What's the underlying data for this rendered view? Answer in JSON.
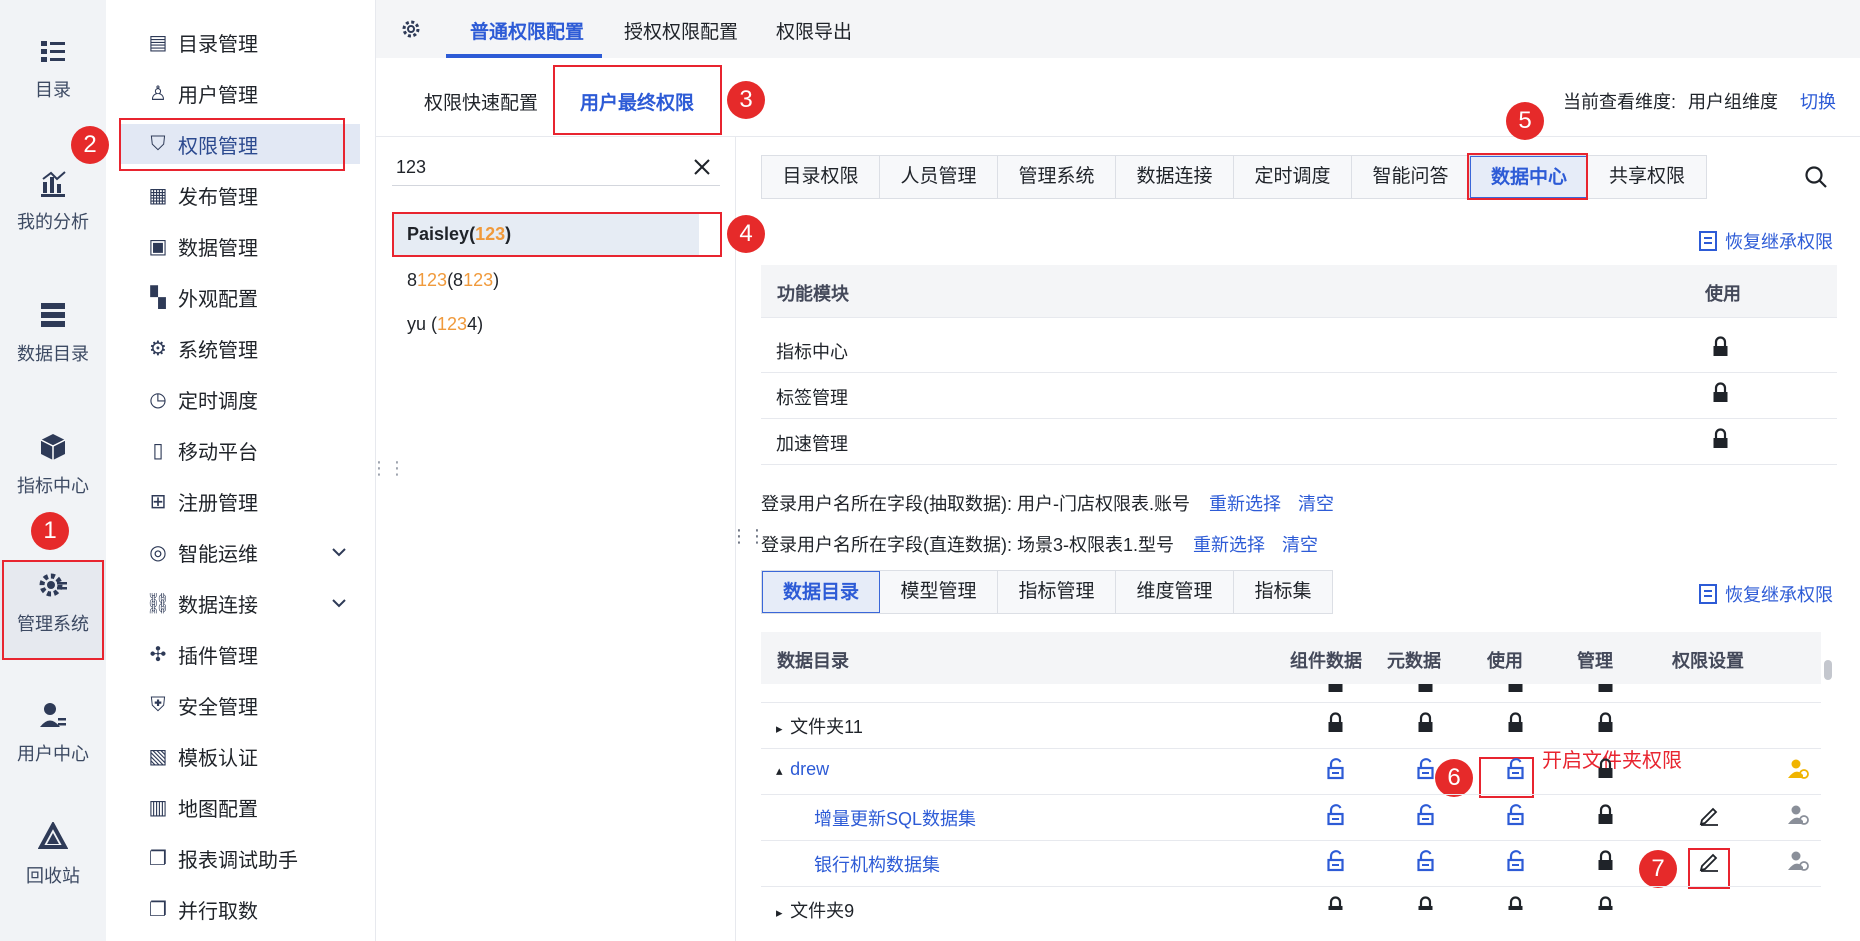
{
  "rail": {
    "items": [
      {
        "label": "目录",
        "icon": "catalog-icon"
      },
      {
        "label": "我的分析",
        "icon": "analysis-icon"
      },
      {
        "label": "数据目录",
        "icon": "data-catalog-icon"
      },
      {
        "label": "指标中心",
        "icon": "cube-icon"
      },
      {
        "label": "管理系统",
        "icon": "gear-icon"
      },
      {
        "label": "用户中心",
        "icon": "user-icon"
      },
      {
        "label": "回收站",
        "icon": "recycle-icon"
      }
    ]
  },
  "menu": {
    "items": [
      {
        "label": "目录管理"
      },
      {
        "label": "用户管理"
      },
      {
        "label": "权限管理"
      },
      {
        "label": "发布管理"
      },
      {
        "label": "数据管理"
      },
      {
        "label": "外观配置"
      },
      {
        "label": "系统管理"
      },
      {
        "label": "定时调度"
      },
      {
        "label": "移动平台"
      },
      {
        "label": "注册管理"
      },
      {
        "label": "智能运维"
      },
      {
        "label": "数据连接"
      },
      {
        "label": "插件管理"
      },
      {
        "label": "安全管理"
      },
      {
        "label": "模板认证"
      },
      {
        "label": "地图配置"
      },
      {
        "label": "报表调试助手"
      },
      {
        "label": "并行取数"
      }
    ]
  },
  "top_tabs": [
    "普通权限配置",
    "授权权限配置",
    "权限导出"
  ],
  "sub_tabs": [
    "权限快速配置",
    "用户最终权限"
  ],
  "dimension": {
    "label": "当前查看维度:",
    "value": "用户组维度",
    "switch": "切换"
  },
  "search": {
    "value": "123"
  },
  "users": [
    {
      "name": "Paisley",
      "open": " (",
      "match": "123",
      "close": ")"
    },
    {
      "pre": "8",
      "match": "123",
      "mid": " (8",
      "match2": "123",
      "close": ")"
    },
    {
      "pre": "yu (",
      "match": "123",
      "close": "4)"
    }
  ],
  "perm_tabs": [
    "目录权限",
    "人员管理",
    "管理系统",
    "数据连接",
    "定时调度",
    "智能问答",
    "数据中心",
    "共享权限"
  ],
  "restore_label": "恢复继承权限",
  "module_table": {
    "headers": [
      "功能模块",
      "使用"
    ],
    "rows": [
      "指标中心",
      "标签管理",
      "加速管理"
    ]
  },
  "login_fields": [
    {
      "text": "登录用户名所在字段(抽取数据): 用户-门店权限表.账号",
      "reselect": "重新选择",
      "clear": "清空"
    },
    {
      "text": "登录用户名所在字段(直连数据): 场景3-权限表1.型号",
      "reselect": "重新选择",
      "clear": "清空"
    }
  ],
  "data_tabs": [
    "数据目录",
    "模型管理",
    "指标管理",
    "维度管理",
    "指标集"
  ],
  "data_table": {
    "headers": [
      "数据目录",
      "组件数据",
      "元数据",
      "使用",
      "管理",
      "权限设置"
    ],
    "rows": [
      {
        "name": "文件夹11"
      },
      {
        "name": "drew"
      },
      {
        "name": "增量更新SQL数据集"
      },
      {
        "name": "银行机构数据集"
      },
      {
        "name": "文件夹9"
      }
    ]
  },
  "annotation": "开启文件夹权限",
  "badges": [
    "1",
    "2",
    "3",
    "4",
    "5",
    "6",
    "7"
  ],
  "colors": {
    "accent": "#2d5bd6",
    "red": "#e8242f",
    "orange": "#f09a3c"
  }
}
